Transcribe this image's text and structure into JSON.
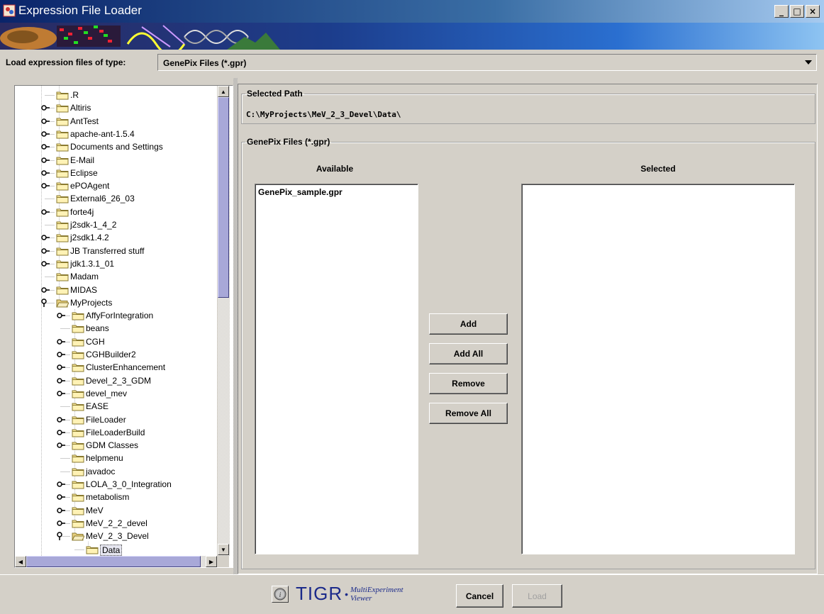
{
  "window": {
    "title": "Expression File Loader",
    "controls": [
      "_",
      "□",
      "×"
    ]
  },
  "type_row": {
    "label": "Load expression files of type:",
    "value": "GenePix Files (*.gpr)"
  },
  "tree": {
    "items": [
      {
        "label": ".R",
        "depth": 1,
        "expandable": false
      },
      {
        "label": "Altiris",
        "depth": 1,
        "expandable": true
      },
      {
        "label": "AntTest",
        "depth": 1,
        "expandable": true
      },
      {
        "label": "apache-ant-1.5.4",
        "depth": 1,
        "expandable": true
      },
      {
        "label": "Documents and Settings",
        "depth": 1,
        "expandable": true
      },
      {
        "label": "E-Mail",
        "depth": 1,
        "expandable": true
      },
      {
        "label": "Eclipse",
        "depth": 1,
        "expandable": true
      },
      {
        "label": "ePOAgent",
        "depth": 1,
        "expandable": true
      },
      {
        "label": "External6_26_03",
        "depth": 1,
        "expandable": false
      },
      {
        "label": "forte4j",
        "depth": 1,
        "expandable": true
      },
      {
        "label": "j2sdk-1_4_2",
        "depth": 1,
        "expandable": false
      },
      {
        "label": "j2sdk1.4.2",
        "depth": 1,
        "expandable": true
      },
      {
        "label": "JB Transferred stuff",
        "depth": 1,
        "expandable": true
      },
      {
        "label": "jdk1.3.1_01",
        "depth": 1,
        "expandable": true
      },
      {
        "label": "Madam",
        "depth": 1,
        "expandable": false
      },
      {
        "label": "MIDAS",
        "depth": 1,
        "expandable": true
      },
      {
        "label": "MyProjects",
        "depth": 1,
        "expandable": true,
        "open": true
      },
      {
        "label": "AffyForIntegration",
        "depth": 2,
        "expandable": true
      },
      {
        "label": "beans",
        "depth": 2,
        "expandable": false
      },
      {
        "label": "CGH",
        "depth": 2,
        "expandable": true
      },
      {
        "label": "CGHBuilder2",
        "depth": 2,
        "expandable": true
      },
      {
        "label": "ClusterEnhancement",
        "depth": 2,
        "expandable": true
      },
      {
        "label": "Devel_2_3_GDM",
        "depth": 2,
        "expandable": true
      },
      {
        "label": "devel_mev",
        "depth": 2,
        "expandable": true
      },
      {
        "label": "EASE",
        "depth": 2,
        "expandable": false
      },
      {
        "label": "FileLoader",
        "depth": 2,
        "expandable": true
      },
      {
        "label": "FileLoaderBuild",
        "depth": 2,
        "expandable": true
      },
      {
        "label": "GDM Classes",
        "depth": 2,
        "expandable": true
      },
      {
        "label": "helpmenu",
        "depth": 2,
        "expandable": false
      },
      {
        "label": "javadoc",
        "depth": 2,
        "expandable": false
      },
      {
        "label": "LOLA_3_0_Integration",
        "depth": 2,
        "expandable": true
      },
      {
        "label": "metabolism",
        "depth": 2,
        "expandable": true
      },
      {
        "label": "MeV",
        "depth": 2,
        "expandable": true
      },
      {
        "label": "MeV_2_2_devel",
        "depth": 2,
        "expandable": true
      },
      {
        "label": "MeV_2_3_Devel",
        "depth": 2,
        "expandable": true,
        "open": true
      },
      {
        "label": "Data",
        "depth": 3,
        "expandable": false,
        "selected": true
      }
    ]
  },
  "selected_path": {
    "legend": "Selected Path",
    "value": "C:\\MyProjects\\MeV_2_3_Devel\\Data\\"
  },
  "files_group": {
    "legend": "GenePix Files (*.gpr)",
    "available_label": "Available",
    "selected_label": "Selected",
    "available_items": [
      "GenePix_sample.gpr"
    ],
    "selected_items": []
  },
  "buttons": {
    "add": "Add",
    "add_all": "Add All",
    "remove": "Remove",
    "remove_all": "Remove All"
  },
  "footer": {
    "logo_text": "TIGR",
    "logo_dot": "•",
    "logo_sub1": "MultiExperiment",
    "logo_sub2": "Viewer",
    "cancel": "Cancel",
    "load": "Load"
  }
}
